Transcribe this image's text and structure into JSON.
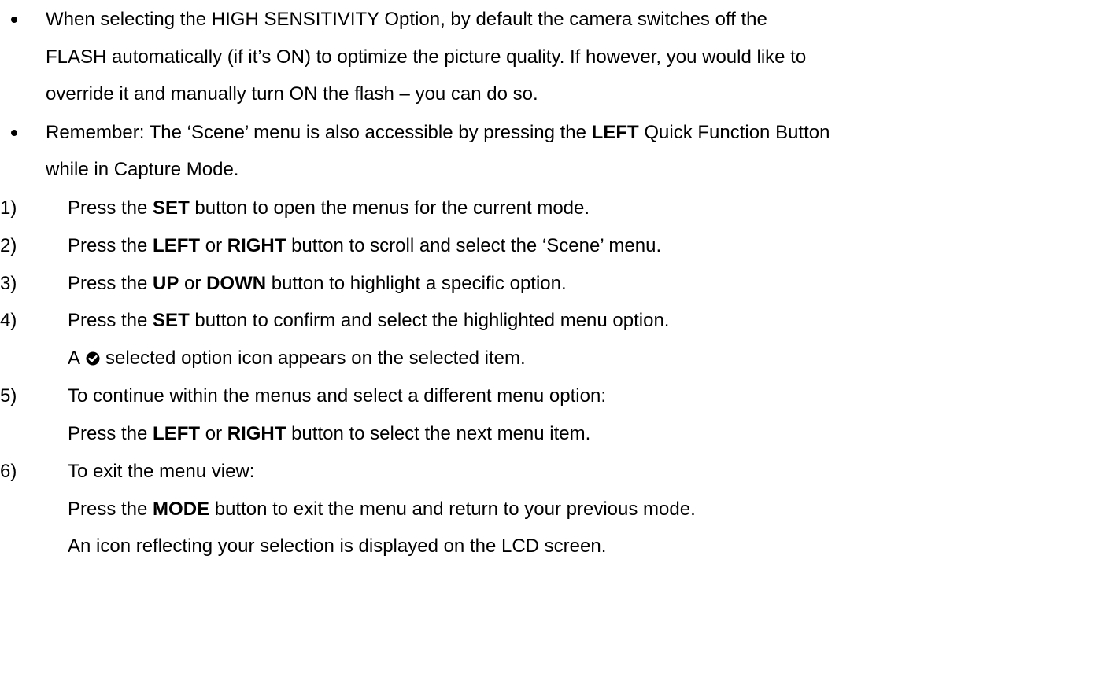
{
  "bullets": [
    {
      "lines": [
        "When selecting the HIGH SENSITIVITY Option, by default the camera switches off the",
        "FLASH automatically (if it’s ON) to optimize the picture quality. If however, you would like to",
        "override it and manually turn ON the flash – you can do so."
      ]
    },
    {
      "line1_pre": "Remember: The ‘Scene’ menu is also accessible by pressing the ",
      "line1_bold": "LEFT",
      "line1_post": " Quick Function Button",
      "line2": "while in Capture Mode."
    }
  ],
  "steps": [
    {
      "num": "1)",
      "t1": "Press the ",
      "b1": "SET",
      "t2": " button to open the menus for the current mode."
    },
    {
      "num": "2)",
      "t1": "Press the ",
      "b1": "LEFT",
      "t2": " or ",
      "b2": "RIGHT",
      "t3": " button to scroll and select the ‘Scene’ menu."
    },
    {
      "num": "3)",
      "t1": "Press the ",
      "b1": "UP",
      "t2": " or ",
      "b2": "DOWN",
      "t3": " button to highlight a specific option."
    },
    {
      "num": "4)",
      "t1": "Press the ",
      "b1": "SET",
      "t2": " button to confirm and select the highlighted menu option.",
      "sub_pre": "A",
      "sub_icon": "check-circle-icon",
      "sub_post": "selected option icon appears on the selected item."
    },
    {
      "num": "5)",
      "line1": "To continue within the menus and select a different menu option:",
      "t1": "Press the ",
      "b1": "LEFT",
      "t2": " or ",
      "b2": "RIGHT",
      "t3": " button to select the next menu item."
    },
    {
      "num": "6)",
      "line1": "To exit the menu view:",
      "t1": "Press the ",
      "b1": "MODE",
      "t2": " button to exit the menu and return to your previous mode.",
      "line3": "An icon reflecting your selection is displayed on the LCD screen."
    }
  ]
}
